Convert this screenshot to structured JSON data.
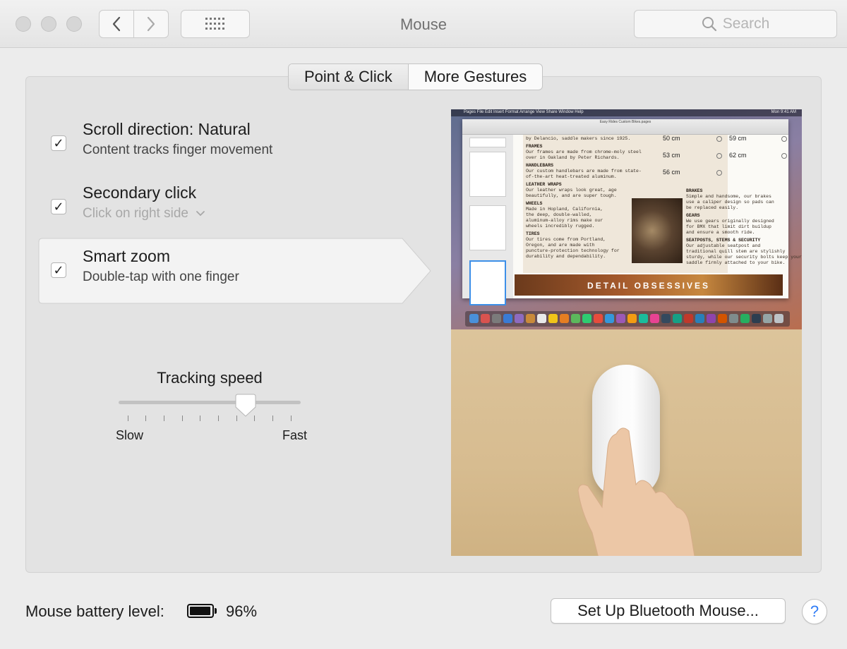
{
  "window": {
    "title": "Mouse"
  },
  "toolbar": {
    "search_placeholder": "Search"
  },
  "tabs": [
    {
      "label": "Point & Click",
      "selected": true
    },
    {
      "label": "More Gestures",
      "selected": false
    }
  ],
  "options": [
    {
      "title": "Scroll direction: Natural",
      "subtitle": "Content tracks finger movement",
      "checked": true
    },
    {
      "title": "Secondary click",
      "subtitle": "Click on right side",
      "checked": true,
      "subtitle_disabled": true
    },
    {
      "title": "Smart zoom",
      "subtitle": "Double-tap with one finger",
      "checked": true,
      "highlighted": true
    }
  ],
  "tracking": {
    "label": "Tracking speed",
    "min_label": "Slow",
    "max_label": "Fast",
    "value": 0.75
  },
  "preview": {
    "menubar_text": "Pages   File   Edit   Insert   Format   Arrange   View   Share   Window   Help",
    "menubar_time": "Mon 9:41 AM",
    "doc_title": "Easy Rides Custom Bikes.pages",
    "sizes": [
      "50 cm",
      "59 cm",
      "53 cm",
      "62 cm",
      "56 cm"
    ],
    "doc_left": [
      {
        "head": "",
        "lines": [
          "by Delancio, saddle makers since 1925."
        ]
      },
      {
        "head": "FRAMES",
        "lines": [
          "Our frames are made from chrome-moly steel",
          "over in Oakland by Peter Richards."
        ]
      },
      {
        "head": "HANDLEBARS",
        "lines": [
          "Our custom handlebars are made from state-",
          "of-the-art heat-treated aluminum."
        ]
      },
      {
        "head": "LEATHER WRAPS",
        "lines": [
          "Our leather wraps look great, age",
          "beautifully, and are super tough."
        ]
      },
      {
        "head": "WHEELS",
        "lines": [
          "Made in Hopland, California,",
          "the deep, double-walled,",
          "aluminum-alloy rims make our",
          "wheels incredibly rugged."
        ]
      },
      {
        "head": "TIRES",
        "lines": [
          "Our tires come from Portland,",
          "Oregon, and are made with",
          "puncture-protection technology for",
          "durability and dependability."
        ]
      }
    ],
    "doc_right": [
      {
        "head": "BRAKES",
        "lines": [
          "Simple and handsome, our brakes",
          "use a caliper design so pads can",
          "be replaced easily."
        ]
      },
      {
        "head": "GEARS",
        "lines": [
          "We use gears originally designed",
          "for BMX that limit dirt buildup",
          "and ensure a smooth ride."
        ]
      },
      {
        "head": "SEATPOSTS, STEMS & SECURITY",
        "lines": [
          "Our adjustable seatpost and",
          "traditional quill stem are stylishly",
          "sturdy, while our security bolts keep your",
          "saddle firmly attached to your bike."
        ]
      }
    ],
    "banner": "DETAIL OBSESSIVES"
  },
  "footer": {
    "battery_label": "Mouse battery level:",
    "battery_percent": "96%",
    "battery_level": 0.96,
    "bluetooth_button": "Set Up Bluetooth Mouse...",
    "help_label": "?"
  },
  "colors": {
    "accent": "#2f7cf6",
    "window_bg": "#ececec",
    "panel_bg": "#e3e3e3"
  }
}
